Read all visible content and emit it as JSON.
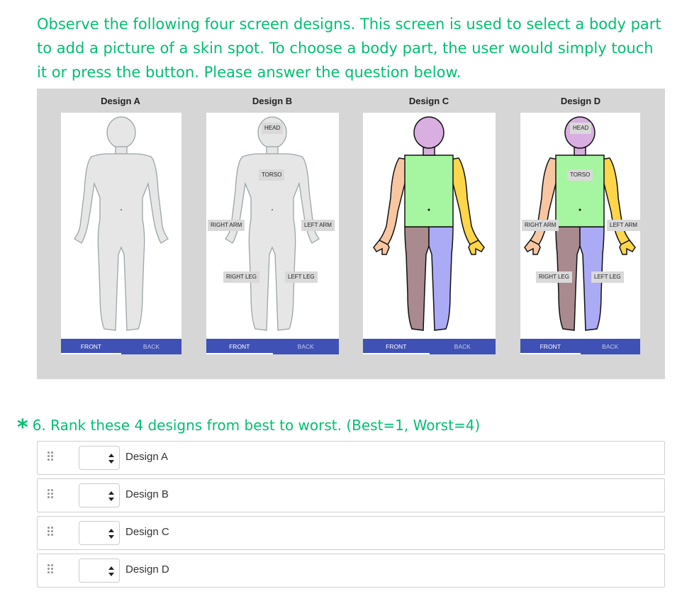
{
  "intro_text": "Observe the following four screen designs. This screen is used to select a body part to add a picture of a skin spot. To choose a body part, the user would simply touch it or press the button. Please answer the question below.",
  "designs": [
    {
      "title": "Design A",
      "tabs": [
        "FRONT",
        "BACK"
      ],
      "labels": {}
    },
    {
      "title": "Design B",
      "tabs": [
        "FRONT",
        "BACK"
      ],
      "labels": {
        "head": "HEAD",
        "torso": "TORSO",
        "right_arm": "RIGHT ARM",
        "left_arm": "LEFT ARM",
        "right_leg": "RIGHT LEG",
        "left_leg": "LEFT LEG"
      }
    },
    {
      "title": "Design C",
      "tabs": [
        "FRONT",
        "BACK"
      ],
      "labels": {}
    },
    {
      "title": "Design D",
      "tabs": [
        "FRONT",
        "BACK"
      ],
      "labels": {
        "head": "HEAD",
        "torso": "TORSO",
        "right_arm": "RIGHT ARM",
        "left_arm": "LEFT ARM",
        "right_leg": "RIGHT LEG",
        "left_leg": "LEFT LEG"
      }
    }
  ],
  "colors": {
    "accent": "#00bf6f",
    "nav_bar": "#3f51b5",
    "figure_bg": "#d6d6d6",
    "body_gray": "#e6e6e6",
    "head_purple": "#d9aee0",
    "torso_green": "#a6f5a0",
    "right_arm_peach": "#f8c6a0",
    "left_arm_yellow": "#ffd54a",
    "right_leg_mauve": "#a98a8f",
    "left_leg_periwinkle": "#aaaaf5"
  },
  "question": {
    "required_marker": "*",
    "text": "6. Rank these 4 designs from best to worst. (Best=1, Worst=4)",
    "options": [
      {
        "label": "Design A",
        "value": ""
      },
      {
        "label": "Design B",
        "value": ""
      },
      {
        "label": "Design C",
        "value": ""
      },
      {
        "label": "Design D",
        "value": ""
      }
    ]
  }
}
